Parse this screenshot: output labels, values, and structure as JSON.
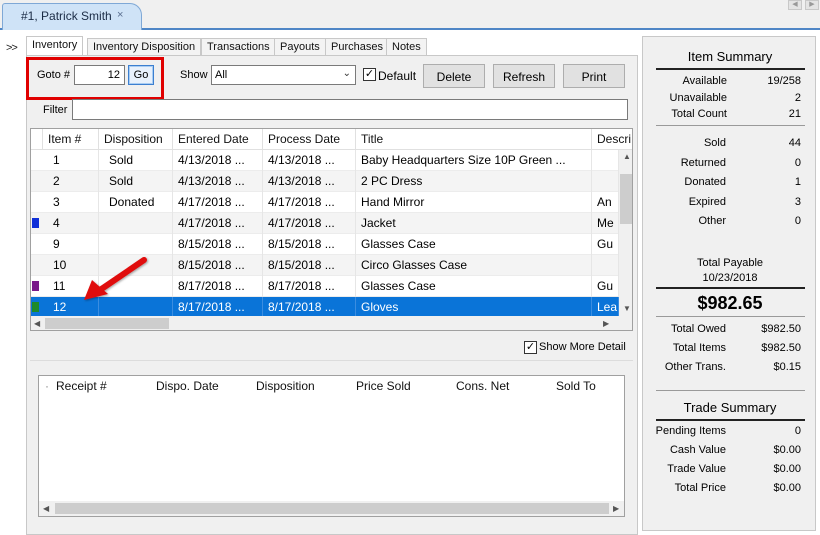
{
  "doc_tab": {
    "title": "#1, Patrick Smith",
    "close": "×"
  },
  "nav": {
    "prev": "◀",
    "next": "▶"
  },
  "chevrons": ">>",
  "tabs": [
    {
      "label": "Inventory",
      "active": true
    },
    {
      "label": "Inventory Disposition"
    },
    {
      "label": "Transactions"
    },
    {
      "label": "Payouts"
    },
    {
      "label": "Purchases"
    },
    {
      "label": "Notes"
    }
  ],
  "toolbar": {
    "goto_label": "Goto #",
    "goto_value": "12",
    "go_button": "Go",
    "show_label": "Show",
    "show_value": "All",
    "default_checked": "✓",
    "default_label": "Default",
    "delete_button": "Delete",
    "refresh_button": "Refresh",
    "print_button": "Print",
    "filter_label": "Filter",
    "filter_value": ""
  },
  "inventory_grid": {
    "columns": [
      "Item #",
      "Disposition",
      "Entered Date",
      "Process Date",
      "Title",
      "Descri"
    ],
    "rows": [
      {
        "item": "1",
        "disposition": "Sold",
        "entered": "4/13/2018 ...",
        "process": "4/13/2018 ...",
        "title": "Baby Headquarters Size 10P Green ...",
        "descr": "",
        "marker": ""
      },
      {
        "item": "2",
        "disposition": "Sold",
        "entered": "4/13/2018 ...",
        "process": "4/13/2018 ...",
        "title": "2 PC Dress",
        "descr": "",
        "marker": ""
      },
      {
        "item": "3",
        "disposition": "Donated",
        "entered": "4/17/2018 ...",
        "process": "4/17/2018 ...",
        "title": "Hand Mirror",
        "descr": "An",
        "marker": ""
      },
      {
        "item": "4",
        "disposition": "",
        "entered": "4/17/2018 ...",
        "process": "4/17/2018 ...",
        "title": "Jacket",
        "descr": "Me",
        "marker": "#1030d8"
      },
      {
        "item": "9",
        "disposition": "",
        "entered": "8/15/2018 ...",
        "process": "8/15/2018 ...",
        "title": "Glasses Case",
        "descr": "Gu",
        "marker": ""
      },
      {
        "item": "10",
        "disposition": "",
        "entered": "8/15/2018 ...",
        "process": "8/15/2018 ...",
        "title": "Circo Glasses Case",
        "descr": "",
        "marker": ""
      },
      {
        "item": "11",
        "disposition": "",
        "entered": "8/17/2018 ...",
        "process": "8/17/2018 ...",
        "title": "Glasses Case",
        "descr": "Gu",
        "marker": "#7a1a8a"
      },
      {
        "item": "12",
        "disposition": "",
        "entered": "8/17/2018 ...",
        "process": "8/17/2018 ...",
        "title": "Gloves",
        "descr": "Lea",
        "marker": "#1e8a2a",
        "selected": true
      }
    ]
  },
  "show_more": {
    "checked": "✓",
    "label": "Show More Detail"
  },
  "receipts_grid": {
    "columns": [
      "Receipt #",
      "Dispo. Date",
      "Disposition",
      "Price Sold",
      "Cons. Net",
      "Sold To"
    ]
  },
  "item_summary": {
    "title": "Item Summary",
    "available_label": "Available",
    "available": "19/258",
    "unavailable_label": "Unavailable",
    "unavailable": "2",
    "total_count_label": "Total Count",
    "total_count": "21",
    "sold_label": "Sold",
    "sold": "44",
    "returned_label": "Returned",
    "returned": "0",
    "donated_label": "Donated",
    "donated": "1",
    "expired_label": "Expired",
    "expired": "3",
    "other_label": "Other",
    "other": "0",
    "total_payable_label": "Total Payable",
    "total_payable_date": "10/23/2018",
    "total_payable_amount": "$982.65",
    "total_owed_label": "Total Owed",
    "total_owed": "$982.50",
    "total_items_label": "Total Items",
    "total_items": "$982.50",
    "other_trans_label": "Other Trans.",
    "other_trans": "$0.15"
  },
  "trade_summary": {
    "title": "Trade Summary",
    "pending_label": "Pending Items",
    "pending": "0",
    "cash_label": "Cash Value",
    "cash": "$0.00",
    "trade_label": "Trade Value",
    "trade": "$0.00",
    "total_price_label": "Total Price",
    "total_price": "$0.00"
  },
  "colors": {
    "accent": "#0a74d8",
    "highlight": "#e00000"
  }
}
